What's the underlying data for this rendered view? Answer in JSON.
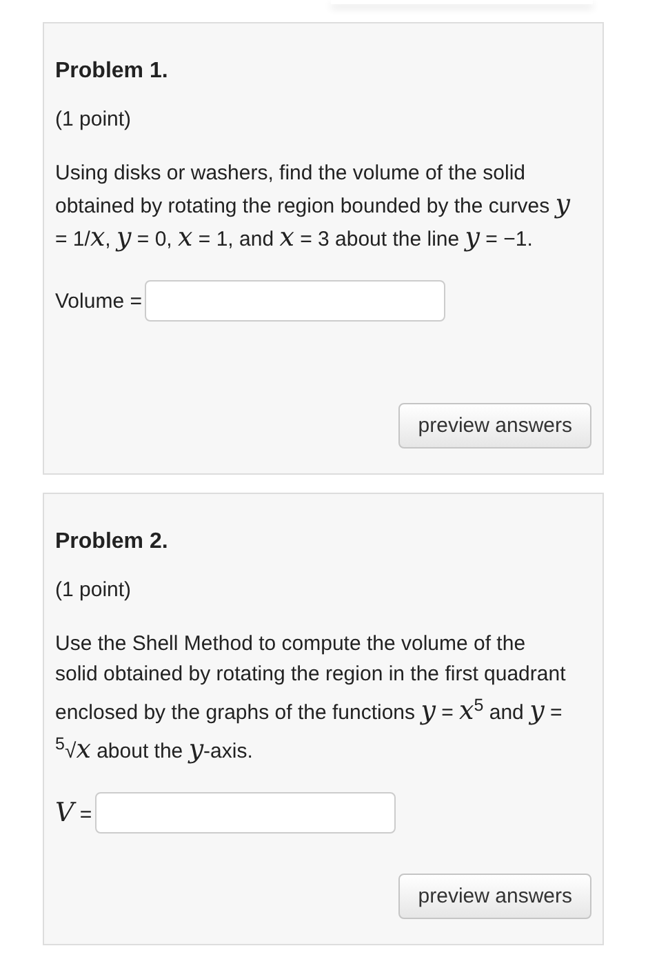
{
  "problems": [
    {
      "title": "Problem 1.",
      "points": "(1 point)",
      "statement": "Using disks or washers, find the volume of the solid obtained by rotating the region bounded by the curves *y* = 1/*x*, *y* = 0, *x* = 1, and *x* = 3 about the line *y* = −1.",
      "answer_label": "Volume =",
      "button": "preview answers"
    },
    {
      "title": "Problem 2.",
      "points": "(1 point)",
      "statement": "Use the Shell Method to compute the volume of the solid obtained by rotating the region in the first quadrant enclosed by the graphs of the functions *y* = *x*$^{5}$ and *y* = $^{5}$√*x* about the *y*-axis.",
      "answer_label": "*V* =",
      "button": "preview answers"
    }
  ]
}
